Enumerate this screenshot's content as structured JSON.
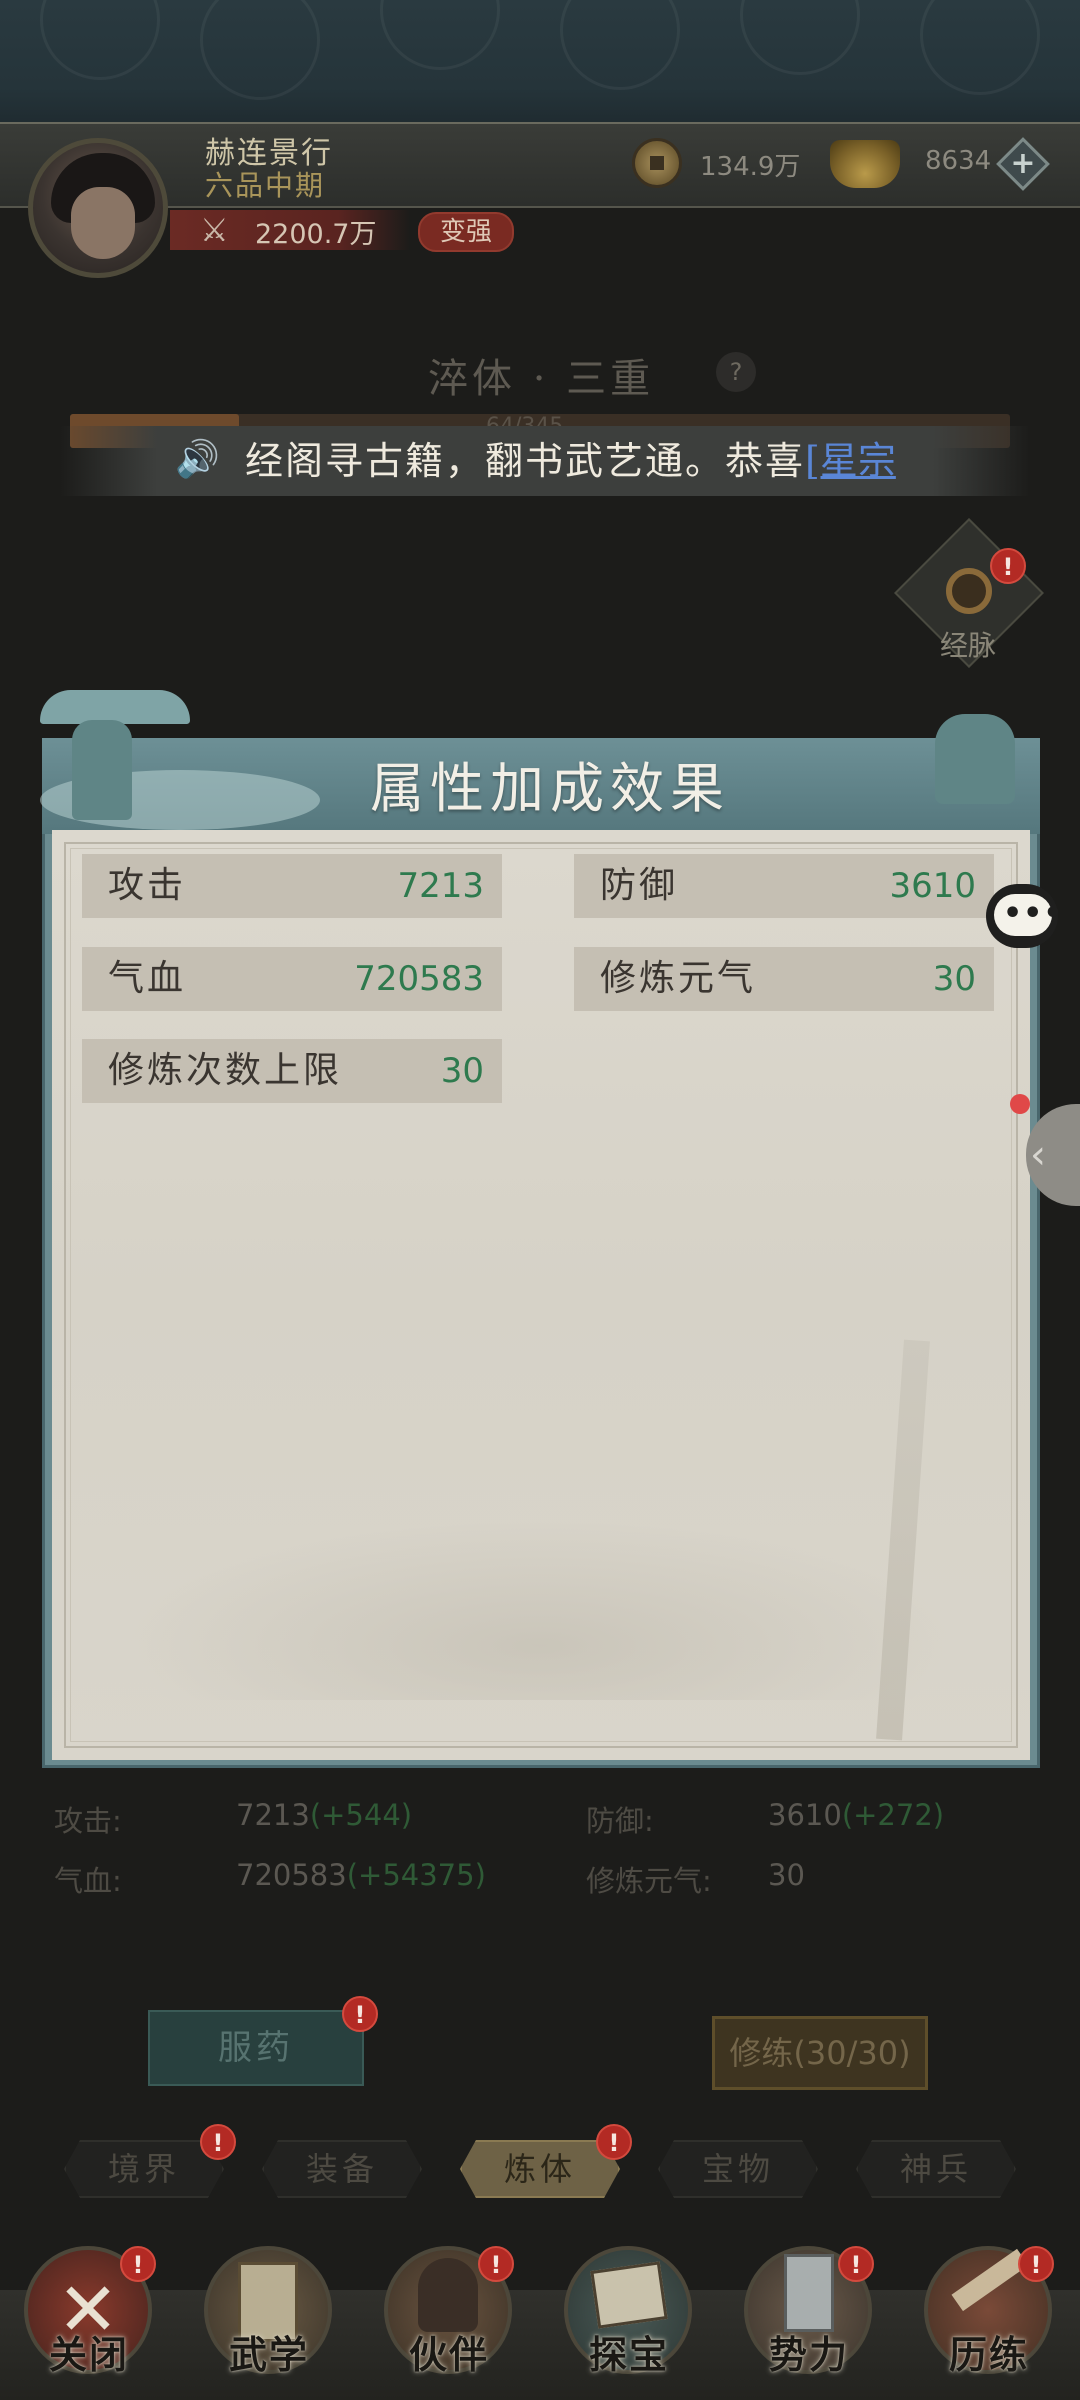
{
  "player": {
    "name": "赫连景行",
    "rank": "六品中期",
    "power": "2200.7万",
    "strengthen_label": "变强"
  },
  "currency": {
    "coins": "134.9万",
    "ingots": "8634",
    "add_icon": "+"
  },
  "realm": {
    "title": "淬体 · 三重",
    "help_icon": "?",
    "progress_text": "64/345",
    "progress_fraction": 0.18
  },
  "announcement": {
    "text": "经阁寻古籍，翻书武艺通。恭喜",
    "link_text": "[星宗"
  },
  "side": {
    "meridian_label": "经脉",
    "badge": "!"
  },
  "modal": {
    "title": "属性加成效果",
    "stats": [
      {
        "label": "攻击",
        "value": "7213"
      },
      {
        "label": "防御",
        "value": "3610"
      },
      {
        "label": "气血",
        "value": "720583"
      },
      {
        "label": "修炼元气",
        "value": "30"
      },
      {
        "label": "修炼次数上限",
        "value": "30"
      }
    ]
  },
  "summary": {
    "attack_label": "攻击:",
    "attack_value": "7213",
    "attack_inc": "(+544)",
    "defense_label": "防御:",
    "defense_value": "3610",
    "defense_inc": "(+272)",
    "hp_label": "气血:",
    "hp_value": "720583",
    "hp_inc": "(+54375)",
    "qi_label": "修炼元气:",
    "qi_value": "30"
  },
  "actions": {
    "medicine": "服药",
    "cultivate": "修练(30/30)"
  },
  "category_tabs": [
    "境界",
    "装备",
    "炼体",
    "宝物",
    "神兵"
  ],
  "active_tab": "炼体",
  "bottom_nav": [
    "关闭",
    "武学",
    "伙伴",
    "探宝",
    "势力",
    "历练"
  ],
  "colors": {
    "accent_green": "#2e7a4e",
    "badge_red": "#b32a24",
    "modal_teal": "#6b8b90"
  }
}
